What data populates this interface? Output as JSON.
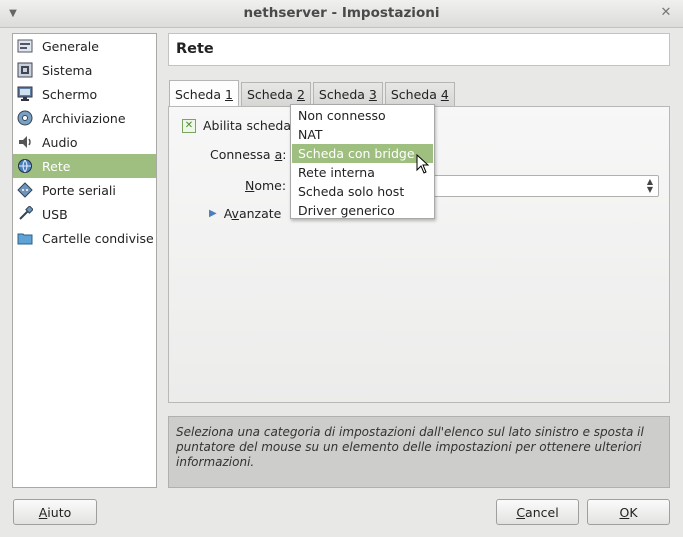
{
  "window": {
    "title": "nethserver - Impostazioni"
  },
  "sidebar": {
    "items": [
      {
        "label": "Generale",
        "icon": "general-icon",
        "selected": false
      },
      {
        "label": "Sistema",
        "icon": "system-icon",
        "selected": false
      },
      {
        "label": "Schermo",
        "icon": "display-icon",
        "selected": false
      },
      {
        "label": "Archiviazione",
        "icon": "storage-icon",
        "selected": false
      },
      {
        "label": "Audio",
        "icon": "audio-icon",
        "selected": false
      },
      {
        "label": "Rete",
        "icon": "network-icon",
        "selected": true
      },
      {
        "label": "Porte seriali",
        "icon": "serial-ports-icon",
        "selected": false
      },
      {
        "label": "USB",
        "icon": "usb-icon",
        "selected": false
      },
      {
        "label": "Cartelle condivise",
        "icon": "shared-folders-icon",
        "selected": false
      }
    ]
  },
  "header": {
    "title": "Rete"
  },
  "tabs": [
    {
      "label": "Scheda ",
      "mnemonic": "1",
      "active": true
    },
    {
      "label": "Scheda ",
      "mnemonic": "2",
      "active": false
    },
    {
      "label": "Scheda ",
      "mnemonic": "3",
      "active": false
    },
    {
      "label": "Scheda ",
      "mnemonic": "4",
      "active": false
    }
  ],
  "adapter": {
    "enable_label": "Abilita scheda",
    "enabled": true,
    "attached_label_pre": "Connessa ",
    "attached_label_mnemonic": "a",
    "attached_label_post": ":",
    "name_label_mnemonic": "N",
    "name_label_post": "ome:",
    "advanced_mnemonic": "v",
    "advanced_pre": "A",
    "advanced_post": "anzate"
  },
  "attached_dropdown": {
    "options": [
      "Non connesso",
      "NAT",
      "Scheda con bridge",
      "Rete interna",
      "Scheda solo host",
      "Driver generico"
    ],
    "highlighted_index": 2
  },
  "info": {
    "text": "Seleziona una categoria di impostazioni dall'elenco sul lato sinistro e sposta il puntatore del mouse su un elemento delle impostazioni per ottenere ulteriori informazioni."
  },
  "buttons": {
    "help_mnemonic": "A",
    "help_rest": "iuto",
    "cancel_mnemonic": "C",
    "cancel_rest": "ancel",
    "ok_mnemonic": "O",
    "ok_rest": "K"
  },
  "colors": {
    "selection": "#9ebf7f",
    "accent_blue": "#4a7fbf"
  }
}
